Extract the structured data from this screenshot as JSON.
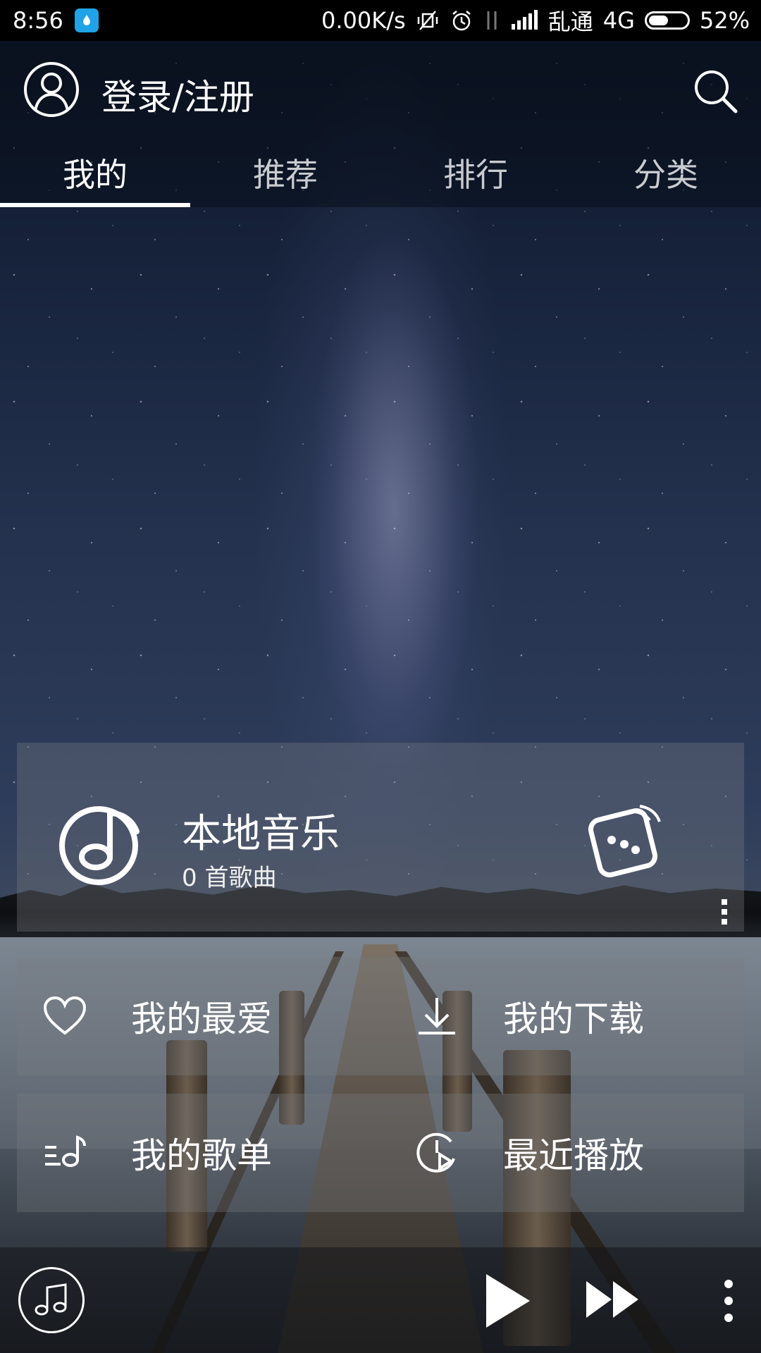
{
  "status_bar": {
    "time": "8:56",
    "network_speed": "0.00K/s",
    "carrier": "乱通",
    "network_type": "4G",
    "battery": "52%",
    "battery_level": 0.52
  },
  "header": {
    "login_label": "登录/注册",
    "tabs": [
      {
        "label": "我的",
        "active": true
      },
      {
        "label": "推荐",
        "active": false
      },
      {
        "label": "排行",
        "active": false
      },
      {
        "label": "分类",
        "active": false
      }
    ]
  },
  "local_music": {
    "title": "本地音乐",
    "subtitle": "0 首歌曲"
  },
  "shortcuts": {
    "favorites": "我的最爱",
    "downloads": "我的下载",
    "playlists": "我的歌单",
    "recent": "最近播放"
  },
  "icons": {
    "avatar": "user-avatar-icon",
    "search": "search-icon",
    "local_music": "music-note-icon",
    "shuffle": "dice-icon",
    "favorites": "heart-icon",
    "downloads": "download-icon",
    "playlists": "playlist-icon",
    "recent": "clock-play-icon",
    "play": "play-icon",
    "next": "fast-forward-icon",
    "more": "more-vertical-icon"
  },
  "colors": {
    "status_app_icon": "#1fa3e8",
    "text": "#ffffff",
    "tab_inactive": "#c9cbd0"
  }
}
